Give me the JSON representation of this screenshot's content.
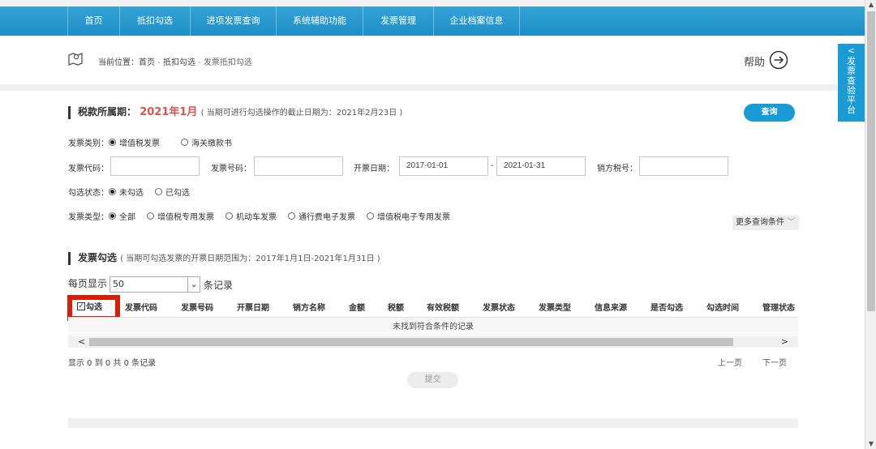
{
  "nav": {
    "items": [
      "首页",
      "抵扣勾选",
      "进项发票查询",
      "系统辅助功能",
      "发票管理",
      "企业档案信息"
    ]
  },
  "breadcrumb": {
    "prefix": "当前位置：",
    "items": [
      "首页",
      "抵扣勾选",
      "发票抵扣勾选"
    ],
    "separator": " - "
  },
  "help": {
    "label": "帮助"
  },
  "side_tab": {
    "arrow": "<",
    "label": "发票查验平台"
  },
  "tax_period": {
    "title": "税款所属期：",
    "period": "2021年1月",
    "note": "( 当期可进行勾选操作的截止日期为：2021年2月23日 )"
  },
  "query_button": "查询",
  "invoice_category": {
    "label": "发票类别：",
    "options": [
      "增值税发票",
      "海关缴款书"
    ],
    "selected": 0
  },
  "fields": {
    "code_label": "发票代码：",
    "code_value": "",
    "number_label": "发票号码：",
    "number_value": "",
    "date_label": "开票日期：",
    "date_from": "2017-01-01",
    "date_sep": "-",
    "date_to": "2021-01-31",
    "seller_tax_label": "销方税号：",
    "seller_tax_value": ""
  },
  "check_status": {
    "label": "勾选状态：",
    "options": [
      "未勾选",
      "已勾选"
    ],
    "selected": 0
  },
  "invoice_type": {
    "label": "发票类型：",
    "options": [
      "全部",
      "增值税专用发票",
      "机动车发票",
      "通行费电子发票",
      "增值税电子专用发票"
    ],
    "selected": 0
  },
  "more_conditions": "更多查询条件",
  "invoice_check": {
    "title": "发票勾选",
    "note": "( 当期可勾选发票的开票日期范围为：2017年1月1日-2021年1月31日 )"
  },
  "pagination": {
    "per_page_label": "每页显示",
    "per_page_value": "50",
    "records_label": "条记录",
    "info": "显示 0 到 0 共 0 条记录",
    "prev": "上一页",
    "next": "下一页"
  },
  "table": {
    "check_header": "勾选",
    "headers": [
      "发票代码",
      "发票号码",
      "开票日期",
      "销方名称",
      "金额",
      "税额",
      "有效税额",
      "发票状态",
      "发票类型",
      "信息来源",
      "是否勾选",
      "勾选时间",
      "管理状态"
    ],
    "empty_message": "未找到符合条件的记录"
  },
  "submit_button": "提交"
}
